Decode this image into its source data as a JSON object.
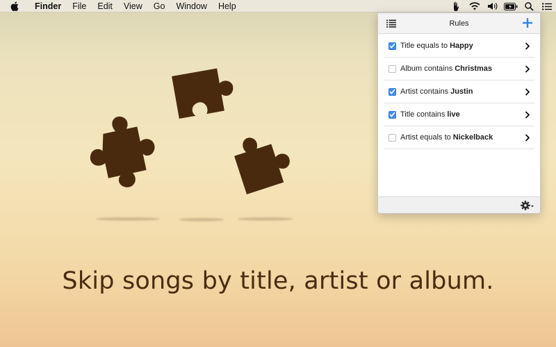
{
  "menubar": {
    "app_name": "Finder",
    "items": [
      "File",
      "Edit",
      "View",
      "Go",
      "Window",
      "Help"
    ],
    "status_icons": [
      "hand-icon",
      "wifi-icon",
      "volume-icon",
      "battery-icon",
      "search-icon",
      "list-icon"
    ]
  },
  "panel": {
    "title": "Rules",
    "rules": [
      {
        "prefix": "Title equals to",
        "value": "Happy",
        "checked": true
      },
      {
        "prefix": "Album contains",
        "value": "Christmas",
        "checked": false
      },
      {
        "prefix": "Artist contains",
        "value": "Justin",
        "checked": true
      },
      {
        "prefix": "Title contains",
        "value": "live",
        "checked": true
      },
      {
        "prefix": "Artist equals to",
        "value": "Nickelback",
        "checked": false
      }
    ]
  },
  "tagline": "Skip songs by title, artist or album.",
  "colors": {
    "accent": "#3f8ef4",
    "puzzle": "#4a2a0e",
    "tagline": "#4a2c10"
  }
}
